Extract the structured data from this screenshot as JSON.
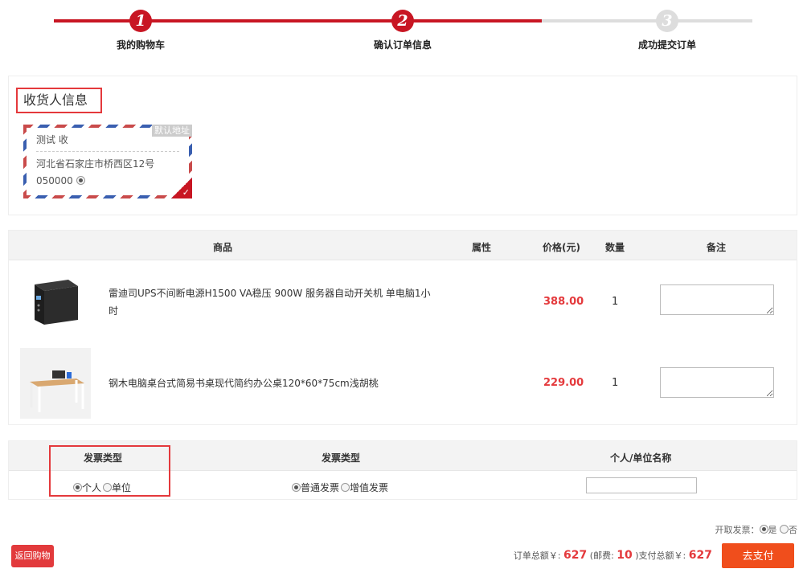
{
  "steps": [
    {
      "number": "1",
      "label": "我的购物车",
      "state": "done"
    },
    {
      "number": "2",
      "label": "确认订单信息",
      "state": "current"
    },
    {
      "number": "3",
      "label": "成功提交订单",
      "state": "todo"
    }
  ],
  "consignee": {
    "title": "收货人信息",
    "address_card": {
      "default_tag": "默认地址",
      "name": "测试 收",
      "address": "河北省石家庄市桥西区12号",
      "zip": "050000"
    }
  },
  "goods": {
    "headers": {
      "product": "商品",
      "attr": "属性",
      "price": "价格(元)",
      "qty": "数量",
      "remark": "备注"
    },
    "items": [
      {
        "name": "雷迪司UPS不间断电源H1500 VA稳压 900W 服务器自动开关机 单电脑1小时",
        "price": "388.00",
        "qty": "1",
        "remark": ""
      },
      {
        "name": "钢木电脑桌台式简易书桌现代简约办公桌120*60*75cm浅胡桃",
        "price": "229.00",
        "qty": "1",
        "remark": ""
      }
    ]
  },
  "invoice": {
    "headers": {
      "type1": "发票类型",
      "type2": "发票类型",
      "name": "个人/单位名称"
    },
    "title_options": [
      "个人",
      "单位"
    ],
    "kind_options": [
      "普通发票",
      "增值发票"
    ],
    "name_value": ""
  },
  "footer": {
    "invoice_toggle_label": "开取发票：",
    "invoice_yes": "是",
    "invoice_no": "否",
    "back_label": "返回购物",
    "total_label": "订单总额￥:",
    "total_value": "627",
    "shipping_label": "(邮费:",
    "shipping_value": "10",
    "pay_total_label": ")支付总额￥:",
    "pay_total_value": "627",
    "pay_label": "去支付"
  },
  "colors": {
    "accent": "#c81623",
    "price": "#e4393c",
    "pay": "#f04e1c"
  }
}
